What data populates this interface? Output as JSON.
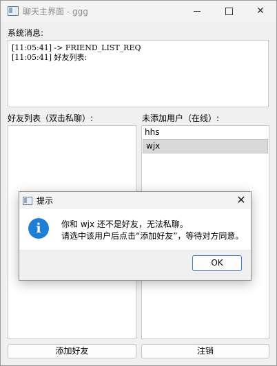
{
  "window": {
    "title": "聊天主界面 - ggg",
    "minimize_label": "minimize",
    "maximize_label": "maximize",
    "close_symbol": "✕"
  },
  "system": {
    "label": "系统消息:",
    "lines": [
      "[11:05:41] -> FRIEND_LIST_REQ",
      "[11:05:41] 好友列表:"
    ]
  },
  "friends": {
    "label": "好友列表（双击私聊）:",
    "items": []
  },
  "pending": {
    "label": "未添加用户（在线）:",
    "items": [
      "hhs",
      "wjx"
    ]
  },
  "buttons": {
    "add_friend": "添加好友",
    "logout": "注销"
  },
  "dialog": {
    "title": "提示",
    "close_symbol": "✕",
    "icon": "information-icon",
    "icon_glyph": "i",
    "message_line1": "你和 wjx 还不是好友，无法私聊。",
    "message_line2": "请选中该用户后点击“添加好友”，等待对方同意。",
    "ok_label": "OK"
  },
  "colors": {
    "accent": "#1f7fd4",
    "selection": "#d9d9d9",
    "ok_border": "#3d7bd6"
  }
}
